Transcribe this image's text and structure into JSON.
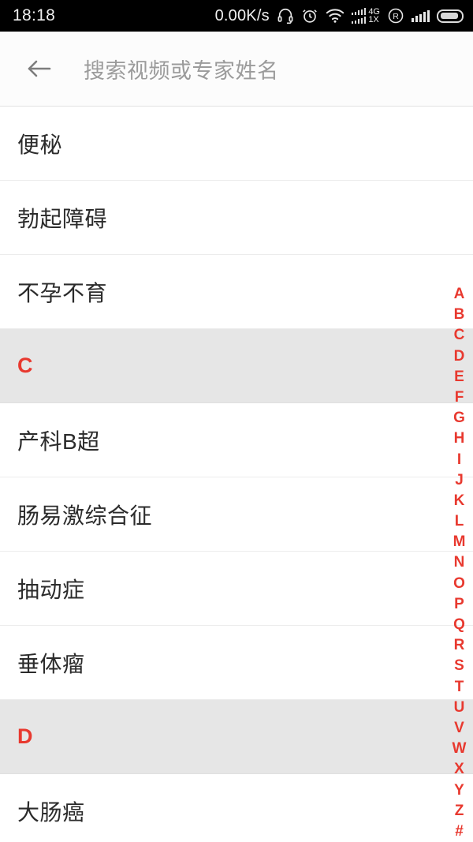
{
  "statusbar": {
    "time": "18:18",
    "network_speed": "0.00K/s",
    "icons": {
      "headset": "headset-icon",
      "alarm": "alarm-clock-icon",
      "wifi": "wifi-icon",
      "sim_signal": "dual-sim-signal-icon",
      "roaming": "roaming-icon",
      "signal": "signal-bars-icon",
      "battery": "battery-icon"
    },
    "sim_label_top": "4G",
    "sim_label_bottom": "1X",
    "roaming_label": "R"
  },
  "header": {
    "back_icon": "back-arrow-icon",
    "search_placeholder": "搜索视频或专家姓名"
  },
  "list": [
    {
      "type": "item",
      "label": "便秘"
    },
    {
      "type": "item",
      "label": "勃起障碍"
    },
    {
      "type": "item",
      "label": "不孕不育"
    },
    {
      "type": "section",
      "label": "C"
    },
    {
      "type": "item",
      "label": "产科B超"
    },
    {
      "type": "item",
      "label": "肠易激综合征"
    },
    {
      "type": "item",
      "label": "抽动症"
    },
    {
      "type": "item",
      "label": "垂体瘤"
    },
    {
      "type": "section",
      "label": "D"
    },
    {
      "type": "item",
      "label": "大肠癌"
    }
  ],
  "index_bar": {
    "letters": [
      "A",
      "B",
      "C",
      "D",
      "E",
      "F",
      "G",
      "H",
      "I",
      "J",
      "K",
      "L",
      "M",
      "N",
      "O",
      "P",
      "Q",
      "R",
      "S",
      "T",
      "U",
      "V",
      "W",
      "X",
      "Y",
      "Z",
      "#"
    ]
  },
  "colors": {
    "accent_red": "#e8392f",
    "section_bg": "#e6e6e6",
    "text_primary": "#2b2b2b",
    "placeholder": "#9b9b9b",
    "statusbar_bg": "#000000"
  }
}
